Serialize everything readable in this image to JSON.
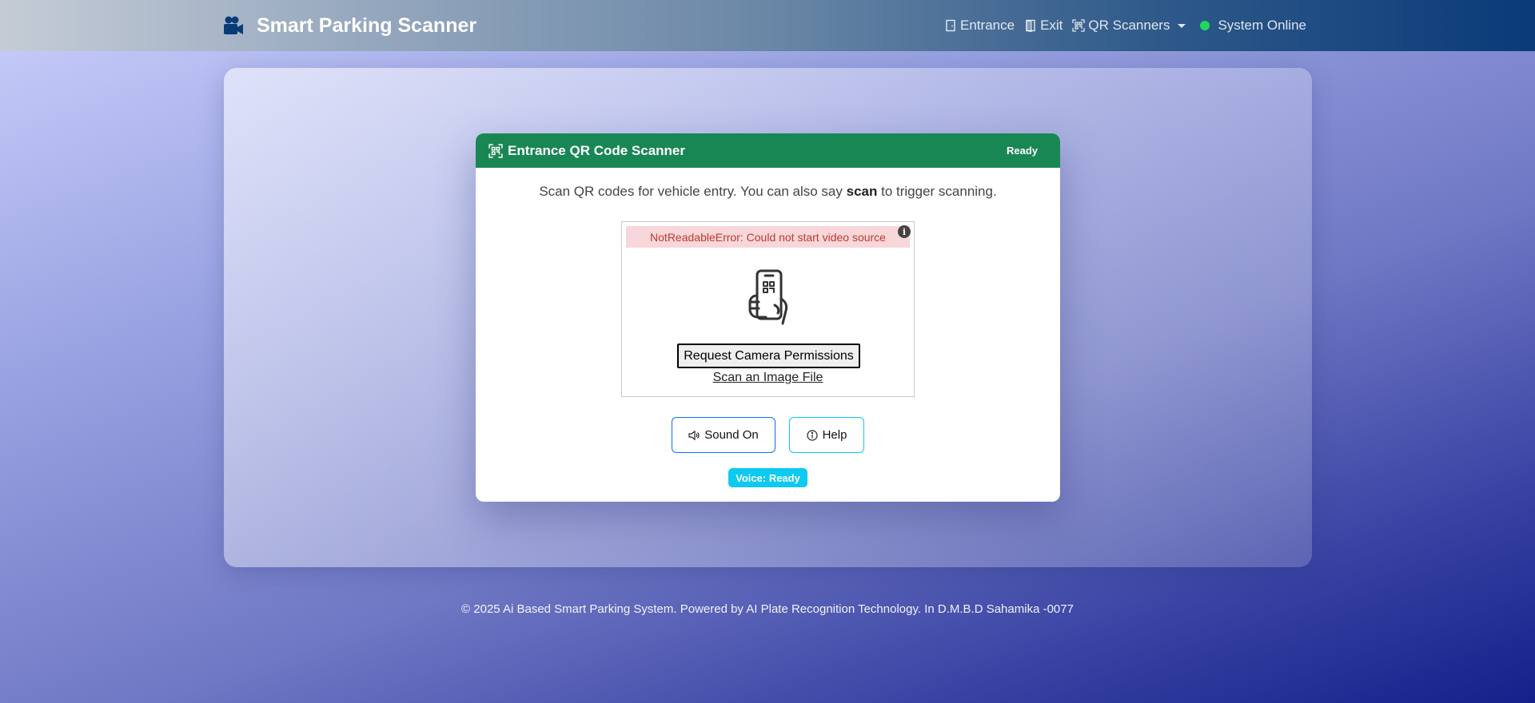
{
  "navbar": {
    "brand_title": "Smart Parking Scanner",
    "brand_icon": "video-camera-icon",
    "links": {
      "entrance": "Entrance",
      "exit": "Exit",
      "qr_scanners": "QR Scanners",
      "status": "System Online"
    },
    "status_color": "#1ed760"
  },
  "card": {
    "title": "Entrance QR Code Scanner",
    "status": "Ready",
    "description_prefix": "Scan QR codes for vehicle entry. You can also say",
    "description_keyword": "scan",
    "description_suffix": "to trigger scanning.",
    "header_color": "#198754"
  },
  "scanner": {
    "error": "NotReadableError: Could not start video source",
    "request_permissions": "Request Camera Permissions",
    "scan_image_file": "Scan an Image File"
  },
  "actions": {
    "sound": "Sound On",
    "help": "Help"
  },
  "voice_badge": "Voice: Ready",
  "footer": "© 2025 Ai Based Smart Parking System. Powered by AI Plate Recognition Technology. In D.M.B.D Sahamika -0077"
}
